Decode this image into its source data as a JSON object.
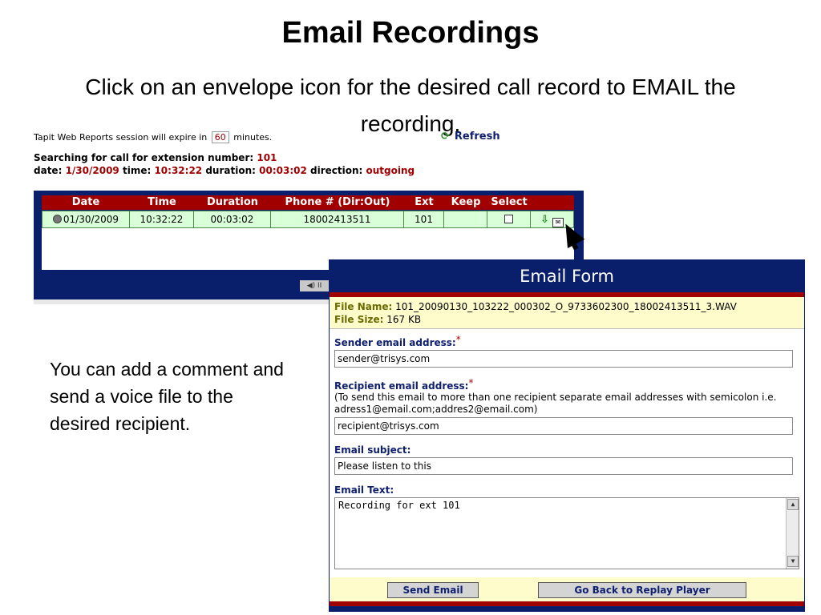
{
  "slide": {
    "title": "Email Recordings",
    "subtitle": "Click on an envelope icon for the desired call record to EMAIL the recording.",
    "comment": "You can add a comment and send a voice file to the desired recipient."
  },
  "report": {
    "session_prefix": "Tapit Web Reports session will expire in",
    "session_minutes": "60",
    "session_suffix": "minutes.",
    "refresh_label": "Refresh",
    "search_label": "Searching for call for extension number:",
    "search_ext": "101",
    "date_label": "date:",
    "date_value": "1/30/2009",
    "time_label": "time:",
    "time_value": "10:32:22",
    "duration_label": "duration:",
    "duration_value": "00:03:02",
    "direction_label": "direction:",
    "direction_value": "outgoing",
    "table": {
      "headers": [
        "Date",
        "Time",
        "Duration",
        "Phone # (Dir:Out)",
        "Ext",
        "Keep",
        "Select"
      ],
      "row": [
        "01/30/2009",
        "10:32:22",
        "00:03:02",
        "18002413511",
        "101",
        "",
        ""
      ]
    },
    "player_label": "◀) II"
  },
  "email_form": {
    "title": "Email Form",
    "file_name_label": "File Name:",
    "file_name_value": "101_20090130_103222_000302_O_9733602300_18002413511_3.WAV",
    "file_size_label": "File Size:",
    "file_size_value": "167 KB",
    "sender_label": "Sender email address:",
    "sender_value": "sender@trisys.com",
    "recipient_label": "Recipient email address:",
    "recipient_note": "(To send this email to more than one recipient separate email addresses with semicolon i.e. adress1@email.com;addres2@email.com)",
    "recipient_value": "recipient@trisys.com",
    "subject_label": "Email subject:",
    "subject_value": "Please listen to this",
    "text_label": "Email Text:",
    "text_value": "Recording for ext 101",
    "required_mark": "*",
    "send_button": "Send Email",
    "back_button": "Go Back to Replay Player"
  }
}
